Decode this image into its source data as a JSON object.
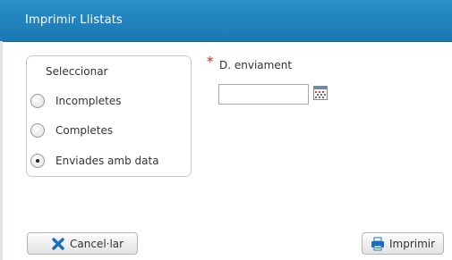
{
  "dialog": {
    "title": "Imprimir Llistats"
  },
  "select_group": {
    "legend": "Seleccionar",
    "options": [
      {
        "label": "Incompletes",
        "selected": false
      },
      {
        "label": "Completes",
        "selected": false
      },
      {
        "label": "Enviades amb data",
        "selected": true
      }
    ]
  },
  "date_field": {
    "required_marker": "*",
    "label": "D. enviament",
    "value": "",
    "icon": "calendar-icon"
  },
  "buttons": {
    "cancel": {
      "label": "Cancel·lar",
      "icon": "x-icon",
      "icon_color": "#1b6fc0"
    },
    "print": {
      "label": "Imprimir",
      "icon": "printer-icon",
      "icon_color": "#1b6fc0"
    }
  },
  "colors": {
    "title_bar": "#1f82bf",
    "required": "#dd2222",
    "accent": "#1b6fc0"
  }
}
